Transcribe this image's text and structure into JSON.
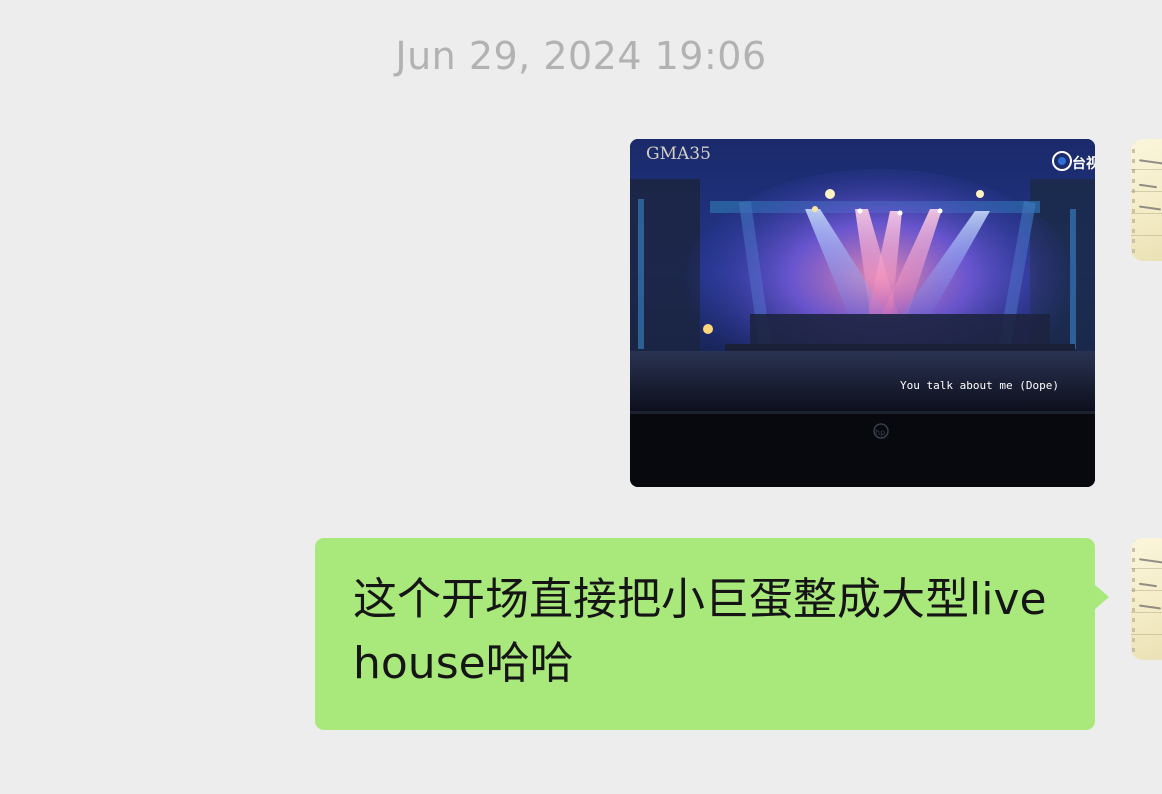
{
  "chat": {
    "timestamp": "Jun 29, 2024 19:06",
    "messages": [
      {
        "type": "image",
        "sender": "self",
        "image": {
          "overlay_logo": "GMA35",
          "channel_logo": "台视",
          "subtitle": "You talk about me  (Dope)",
          "monitor_logo": "hp"
        }
      },
      {
        "type": "text",
        "sender": "self",
        "text": "这个开场直接把小巨蛋整成大型livehouse哈哈"
      }
    ],
    "avatar": {
      "icon": "notebook-avatar-icon"
    }
  },
  "colors": {
    "background": "#ededed",
    "bubble": "#a9e97c",
    "timestamp": "#b2b2b2"
  }
}
